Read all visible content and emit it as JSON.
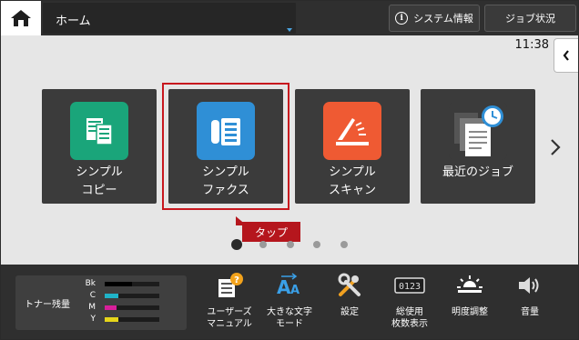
{
  "topbar": {
    "title": "ホーム",
    "system_info_label": "システム情報",
    "job_status_label": "ジョブ状況"
  },
  "clock": "11:38",
  "tiles": [
    {
      "line1": "シンプル",
      "line2": "コピー",
      "color": "#1aa57a",
      "icon": "copy-icon"
    },
    {
      "line1": "シンプル",
      "line2": "ファクス",
      "color": "#2f8fd6",
      "icon": "fax-icon"
    },
    {
      "line1": "シンプル",
      "line2": "スキャン",
      "color": "#ef5a33",
      "icon": "scan-icon"
    },
    {
      "line1": "最近のジョブ",
      "line2": "",
      "color": "#3b3b3b",
      "icon": "recent-jobs-icon"
    }
  ],
  "tap_label": "タップ",
  "page_dots": {
    "count": 5,
    "active": 1
  },
  "toner": {
    "title": "トナー残量",
    "levels": [
      {
        "name": "Bk",
        "level": 0.5,
        "color": "#000000"
      },
      {
        "name": "C",
        "level": 0.25,
        "color": "#1fb3c8"
      },
      {
        "name": "M",
        "level": 0.22,
        "color": "#d81f9a"
      },
      {
        "name": "Y",
        "level": 0.25,
        "color": "#e6d51a"
      }
    ]
  },
  "bottom_items": [
    {
      "line1": "ユーザーズ",
      "line2": "マニュアル",
      "icon": "user-manual-icon"
    },
    {
      "line1": "大きな文字",
      "line2": "モード",
      "icon": "large-text-icon"
    },
    {
      "line1": "設定",
      "line2": "",
      "icon": "settings-icon"
    },
    {
      "line1": "総使用",
      "line2": "枚数表示",
      "icon": "counter-icon"
    },
    {
      "line1": "明度調整",
      "line2": "",
      "icon": "brightness-icon"
    },
    {
      "line1": "音量",
      "line2": "",
      "icon": "volume-icon"
    }
  ]
}
